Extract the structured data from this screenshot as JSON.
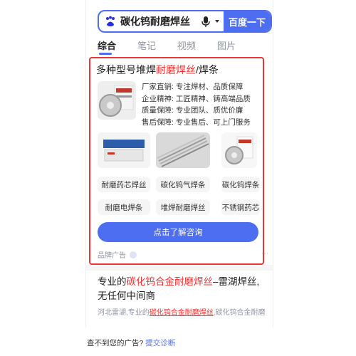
{
  "search": {
    "query": "碳化钨耐磨焊丝",
    "button_label": "百度一下"
  },
  "tabs": [
    {
      "label": "综合",
      "active": true
    },
    {
      "label": "笔记",
      "active": false
    },
    {
      "label": "视频",
      "active": false
    },
    {
      "label": "图片",
      "active": false
    }
  ],
  "ad": {
    "title_prefix": "多种型号堆焊",
    "title_highlight": "耐磨焊丝",
    "title_suffix": "/焊条",
    "features": [
      "厂家直销: 专注焊材、品质保障",
      "企业精神: 工匠精神、铸高端品质",
      "质量保障: 专业团队、质优价廉",
      "售后保障: 专业售后、可上门服务"
    ],
    "keywords_row1": [
      "耐磨药芯焊丝",
      "碳化钨气焊条",
      "碳化钨焊条"
    ],
    "keywords_row2": [
      "耐磨电焊条",
      "堆焊耐磨焊丝",
      "不锈钢药芯"
    ],
    "cta_label": "点击了解咨询",
    "brand_label": "品牌广告",
    "more": "···"
  },
  "result2": {
    "title_prefix": "专业的",
    "title_highlight": "碳化钨合金耐磨焊丝",
    "title_suffix": "–雷湖焊丝,无任何中间商",
    "desc_prefix": "河北雷湖,专业的",
    "desc_highlight": "碳化钨合金耐磨焊丝",
    "desc_suffix": ",碳化钨合金耐磨"
  },
  "footer": {
    "text": "查不到您的广告?",
    "link": "提交诊断"
  },
  "colors": {
    "accent": "#4e6ef2",
    "highlight": "#f73131",
    "ad_border": "#e8373a"
  }
}
